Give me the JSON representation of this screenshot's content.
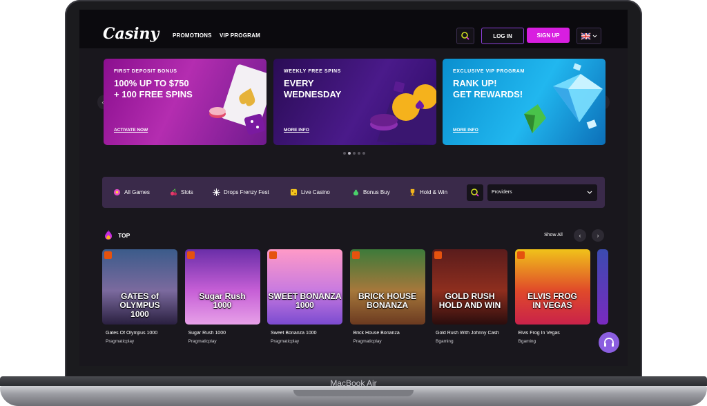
{
  "device": {
    "label": "MacBook Air"
  },
  "header": {
    "logo": "Casiny",
    "nav": [
      "PROMOTIONS",
      "VIP PROGRAM"
    ],
    "login": "LOG IN",
    "signup": "SIGN UP",
    "language_icon": "uk-flag-icon"
  },
  "banners": [
    {
      "kicker": "FIRST DEPOSIT BONUS",
      "title_line1": "100% UP TO $750",
      "title_line2": "+ 100 FREE SPINS",
      "link": "ACTIVATE NOW"
    },
    {
      "kicker": "WEEKLY FREE SPINS",
      "title_line1": "EVERY",
      "title_line2": "WEDNESDAY",
      "link": "MORE INFO"
    },
    {
      "kicker": "EXCLUSIVE VIP PROGRAM",
      "title_line1": "RANK UP!",
      "title_line2": "GET REWARDS!",
      "link": "MORE INFO"
    }
  ],
  "carousel": {
    "active_index": 1,
    "count": 5
  },
  "filters": {
    "items": [
      "All Games",
      "Slots",
      "Drops Frenzy Fest",
      "Live Casino",
      "Bonus Buy",
      "Hold & Win"
    ],
    "providers_placeholder": "Providers"
  },
  "top": {
    "title": "TOP",
    "show_all": "Show All",
    "games": [
      {
        "name": "Gates Of Olympus 1000",
        "provider": "Pragmaticplay",
        "art_line1": "GATES of OLYMPUS",
        "art_line2": "1000",
        "colors": [
          "#3b5b8a",
          "#7b6a9e",
          "#2a2040"
        ]
      },
      {
        "name": "Sugar Rush 1000",
        "provider": "Pragmaticplay",
        "art_line1": "Sugar Rush",
        "art_line2": "1000",
        "colors": [
          "#6a2ea8",
          "#c65fd6",
          "#e7a0e8"
        ]
      },
      {
        "name": "Sweet Bonanza 1000",
        "provider": "Pragmaticplay",
        "art_line1": "SWEET BONANZA",
        "art_line2": "1000",
        "colors": [
          "#ff9ac7",
          "#c87ae0",
          "#7b4bd0"
        ]
      },
      {
        "name": "Brick House Bonanza",
        "provider": "Pragmaticplay",
        "art_line1": "BRICK HOUSE",
        "art_line2": "BONANZA",
        "colors": [
          "#3d7a3a",
          "#a6783b",
          "#6b3a20"
        ]
      },
      {
        "name": "Gold Rush With Johnny Cash",
        "provider": "Bgaming",
        "art_line1": "GOLD RUSH",
        "art_line2": "HOLD AND WIN",
        "colors": [
          "#5a1c1c",
          "#8e2e1e",
          "#2a0d0d"
        ]
      },
      {
        "name": "Elvis Frog In Vegas",
        "provider": "Bgaming",
        "art_line1": "ELVIS FROG",
        "art_line2": "IN VEGAS",
        "colors": [
          "#f0c21a",
          "#e04a2a",
          "#c9224a"
        ]
      }
    ]
  }
}
